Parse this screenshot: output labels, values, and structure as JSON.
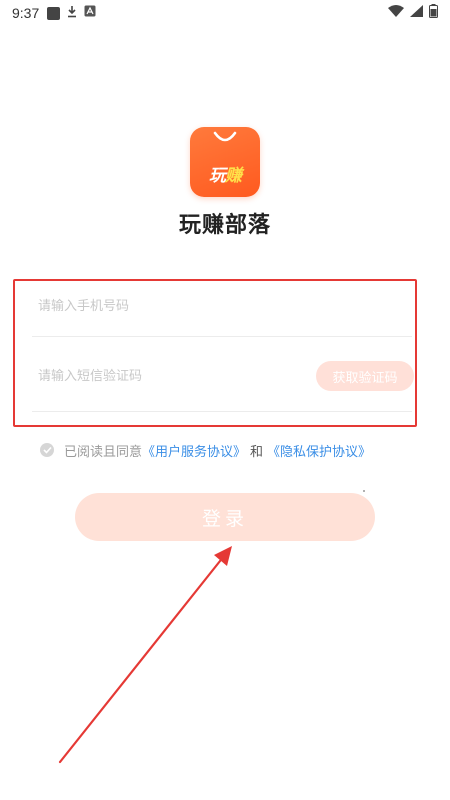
{
  "status_bar": {
    "time": "9:37",
    "icons": [
      "notification-square-icon",
      "download-icon",
      "a-badge-icon",
      "wifi-icon",
      "signal-icon",
      "battery-icon"
    ]
  },
  "logo": {
    "text_part1": "玩",
    "text_part2": "赚",
    "colors": {
      "primary": "#ff5a1f",
      "highlight": "#ffe14a"
    }
  },
  "app_name": "玩赚部落",
  "form": {
    "phone_placeholder": "请输入手机号码",
    "code_placeholder": "请输入短信验证码",
    "get_code_label": "获取验证码"
  },
  "agreement": {
    "prefix": "已阅读且同意",
    "user_agreement_link": "《用户服务协议》",
    "and": "和",
    "privacy_link": "《隐私保护协议》"
  },
  "login_label": "登录",
  "colors": {
    "annotation_red": "#e53935",
    "link_blue": "#3a8ee6",
    "button_bg": "#ffe1d7"
  }
}
